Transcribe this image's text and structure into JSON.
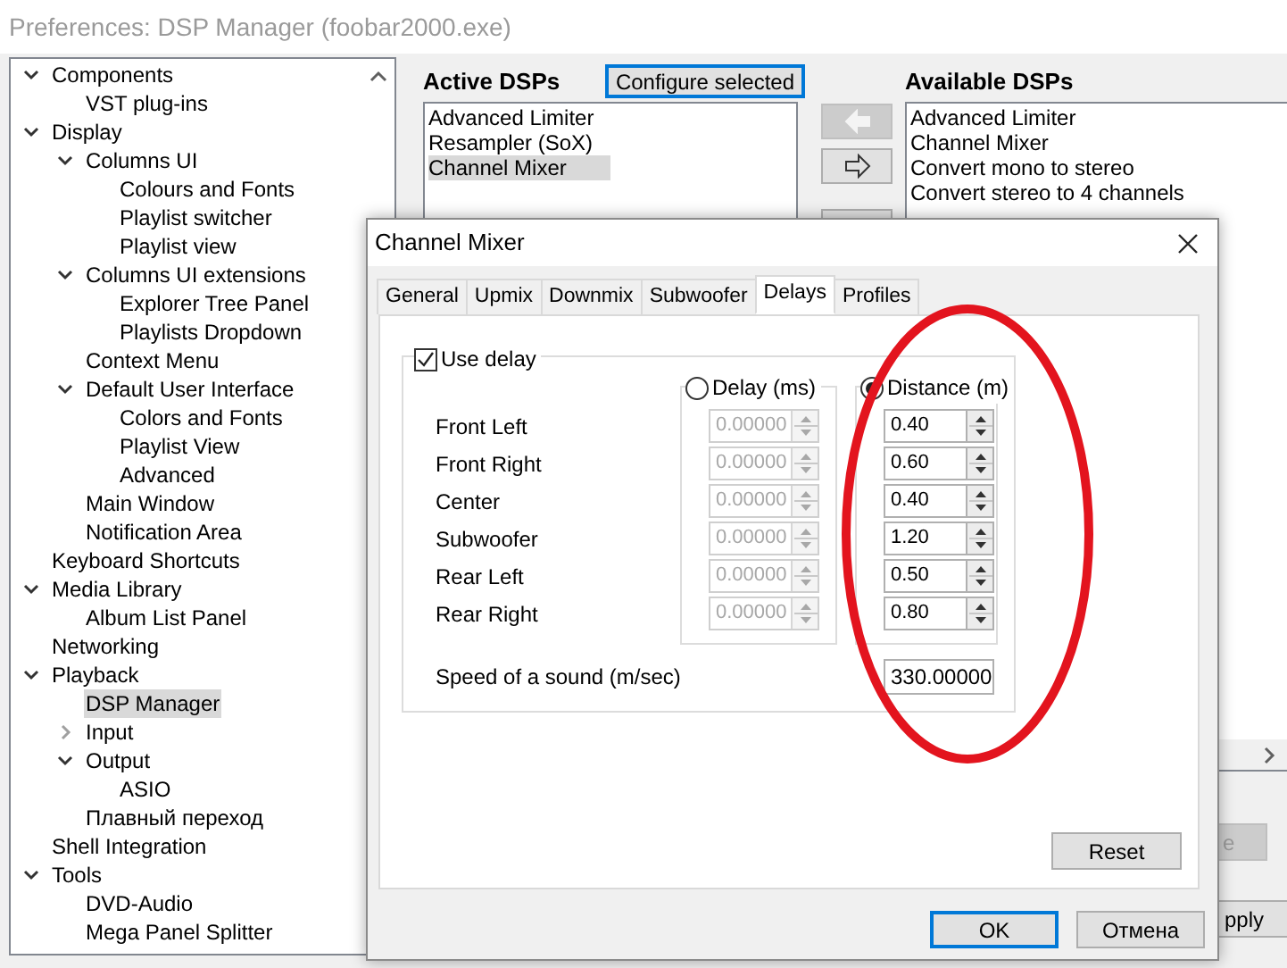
{
  "window": {
    "title": "Preferences: DSP Manager (foobar2000.exe)"
  },
  "tree": [
    {
      "label": "Components",
      "expanded": true,
      "selected": false,
      "children": [
        {
          "label": "VST plug-ins",
          "selected": false
        }
      ]
    },
    {
      "label": "Display",
      "expanded": true,
      "selected": false,
      "children": [
        {
          "label": "Columns UI",
          "expanded": true,
          "selected": false,
          "children": [
            {
              "label": "Colours and Fonts",
              "selected": false
            },
            {
              "label": "Playlist switcher",
              "selected": false
            },
            {
              "label": "Playlist view",
              "selected": false
            }
          ]
        },
        {
          "label": "Columns UI extensions",
          "expanded": true,
          "selected": false,
          "children": [
            {
              "label": "Explorer Tree Panel",
              "selected": false
            },
            {
              "label": "Playlists Dropdown",
              "selected": false
            }
          ]
        },
        {
          "label": "Context Menu",
          "selected": false
        },
        {
          "label": "Default User Interface",
          "expanded": true,
          "selected": false,
          "children": [
            {
              "label": "Colors and Fonts",
              "selected": false
            },
            {
              "label": "Playlist View",
              "selected": false
            },
            {
              "label": "Advanced",
              "selected": false
            }
          ]
        },
        {
          "label": "Main Window",
          "selected": false
        },
        {
          "label": "Notification Area",
          "selected": false
        }
      ]
    },
    {
      "label": "Keyboard Shortcuts",
      "selected": false
    },
    {
      "label": "Media Library",
      "expanded": true,
      "selected": false,
      "children": [
        {
          "label": "Album List Panel",
          "selected": false
        }
      ]
    },
    {
      "label": "Networking",
      "selected": false
    },
    {
      "label": "Playback",
      "expanded": true,
      "selected": false,
      "children": [
        {
          "label": "DSP Manager",
          "selected": true
        },
        {
          "label": "Input",
          "expanded": false,
          "selected": false
        },
        {
          "label": "Output",
          "expanded": true,
          "selected": false,
          "children": [
            {
              "label": "ASIO",
              "selected": false
            }
          ]
        },
        {
          "label": "Плавный переход",
          "selected": false
        }
      ]
    },
    {
      "label": "Shell Integration",
      "selected": false
    },
    {
      "label": "Tools",
      "expanded": true,
      "selected": false,
      "children": [
        {
          "label": "DVD-Audio",
          "selected": false
        },
        {
          "label": "Mega Panel Splitter",
          "selected": false
        }
      ]
    }
  ],
  "active_dsps": {
    "heading": "Active DSPs",
    "items": [
      {
        "label": "Advanced Limiter",
        "selected": false
      },
      {
        "label": "Resampler (SoX)",
        "selected": false
      },
      {
        "label": "Channel Mixer",
        "selected": true
      }
    ]
  },
  "configure_button": "Configure selected",
  "move_buttons": [
    {
      "kind": "left",
      "disabled": true
    },
    {
      "kind": "right",
      "disabled": false
    },
    {
      "kind": "blank",
      "disabled": false
    }
  ],
  "available_dsps": {
    "heading": "Available DSPs",
    "items": [
      "Advanced Limiter",
      "Channel Mixer",
      "Convert mono to stereo",
      "Convert stereo to 4 channels"
    ]
  },
  "bottom_buttons": [
    {
      "label": "e",
      "disabled": true
    },
    {
      "label": "pply",
      "disabled": false
    }
  ],
  "dialog": {
    "title": "Channel Mixer",
    "tabs": [
      {
        "label": "General",
        "selected": false
      },
      {
        "label": "Upmix",
        "selected": false
      },
      {
        "label": "Downmix",
        "selected": false
      },
      {
        "label": "Subwoofer",
        "selected": false
      },
      {
        "label": "Delays",
        "selected": true
      },
      {
        "label": "Profiles",
        "selected": false
      }
    ],
    "use_delay": {
      "label": "Use delay",
      "checked": true
    },
    "modes": [
      {
        "label": "Delay (ms)",
        "selected": false
      },
      {
        "label": "Distance (m)",
        "selected": true
      }
    ],
    "channels": [
      {
        "name": "Front Left",
        "delay": "0.00000",
        "distance": "0.40"
      },
      {
        "name": "Front Right",
        "delay": "0.00000",
        "distance": "0.60"
      },
      {
        "name": "Center",
        "delay": "0.00000",
        "distance": "0.40"
      },
      {
        "name": "Subwoofer",
        "delay": "0.00000",
        "distance": "1.20"
      },
      {
        "name": "Rear Left",
        "delay": "0.00000",
        "distance": "0.50"
      },
      {
        "name": "Rear Right",
        "delay": "0.00000",
        "distance": "0.80"
      }
    ],
    "speed": {
      "label": "Speed of a sound (m/sec)",
      "value": "330.00000"
    },
    "reset_button": "Reset",
    "buttons": [
      {
        "label": "OK",
        "default": true
      },
      {
        "label": "Отмена",
        "default": false
      }
    ]
  }
}
